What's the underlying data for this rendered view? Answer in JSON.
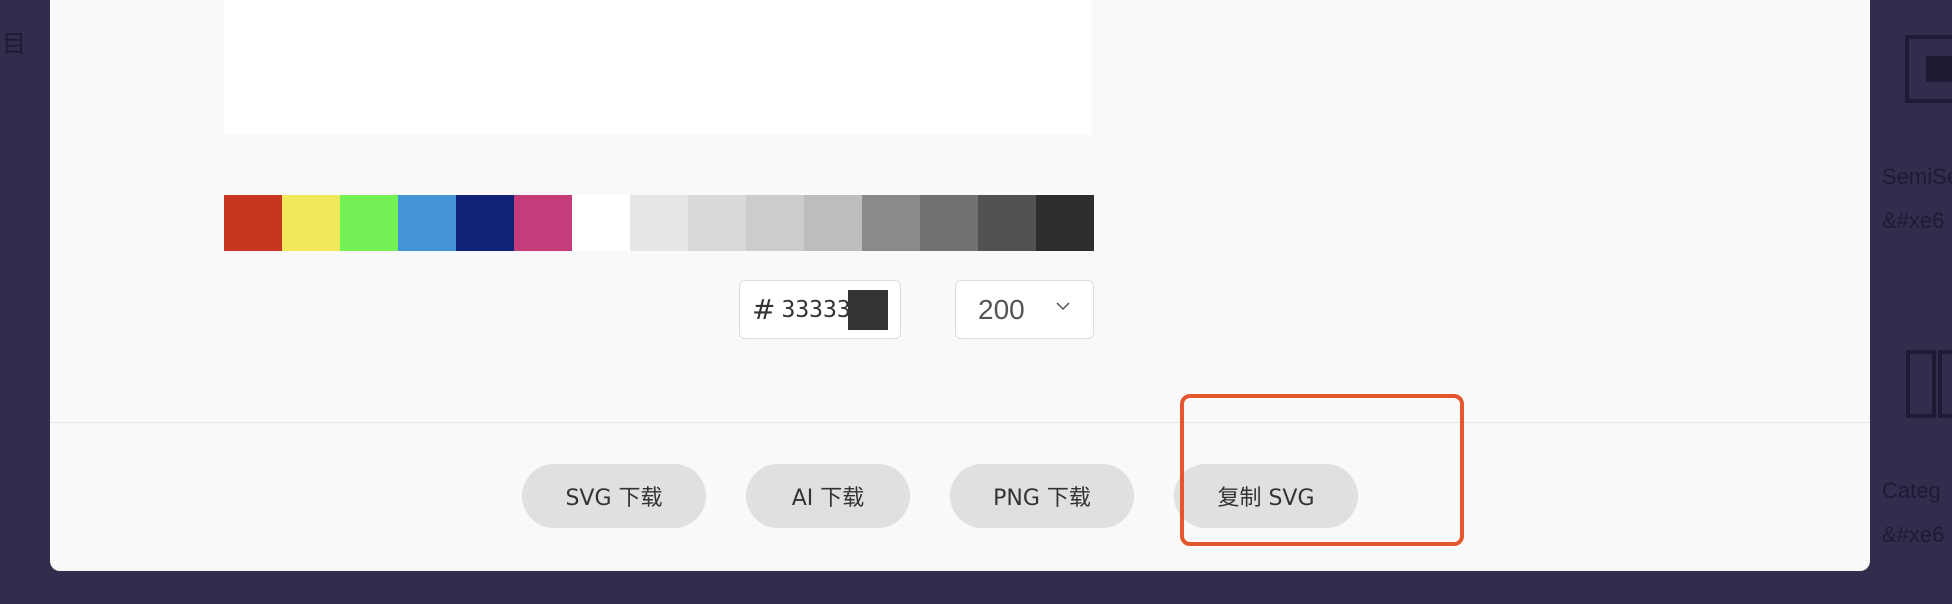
{
  "left_sidebar": {
    "glyph": "目"
  },
  "palette": {
    "swatches": [
      "#c8361f",
      "#f2e85c",
      "#74f255",
      "#4495d8",
      "#112376",
      "#c53c7b",
      "#ffffff",
      "#e6e6e6",
      "#d9d9d9",
      "#cccccc",
      "#bdbdbd",
      "#8a8a8a",
      "#717171",
      "#525252",
      "#2e2e2e"
    ]
  },
  "color_field": {
    "hash": "#",
    "value": "333333",
    "chip_color": "#333333"
  },
  "size_select": {
    "value": "200"
  },
  "buttons": {
    "svg_download": "SVG 下载",
    "ai_download": "AI 下载",
    "png_download": "PNG 下载",
    "copy_svg": "复制 SVG"
  },
  "highlight_color": "#e4572e",
  "right_panel": {
    "item1_name": "SemiSe",
    "item1_code": "&#xe6",
    "item2_name": "Categ",
    "item2_code": "&#xe6"
  }
}
